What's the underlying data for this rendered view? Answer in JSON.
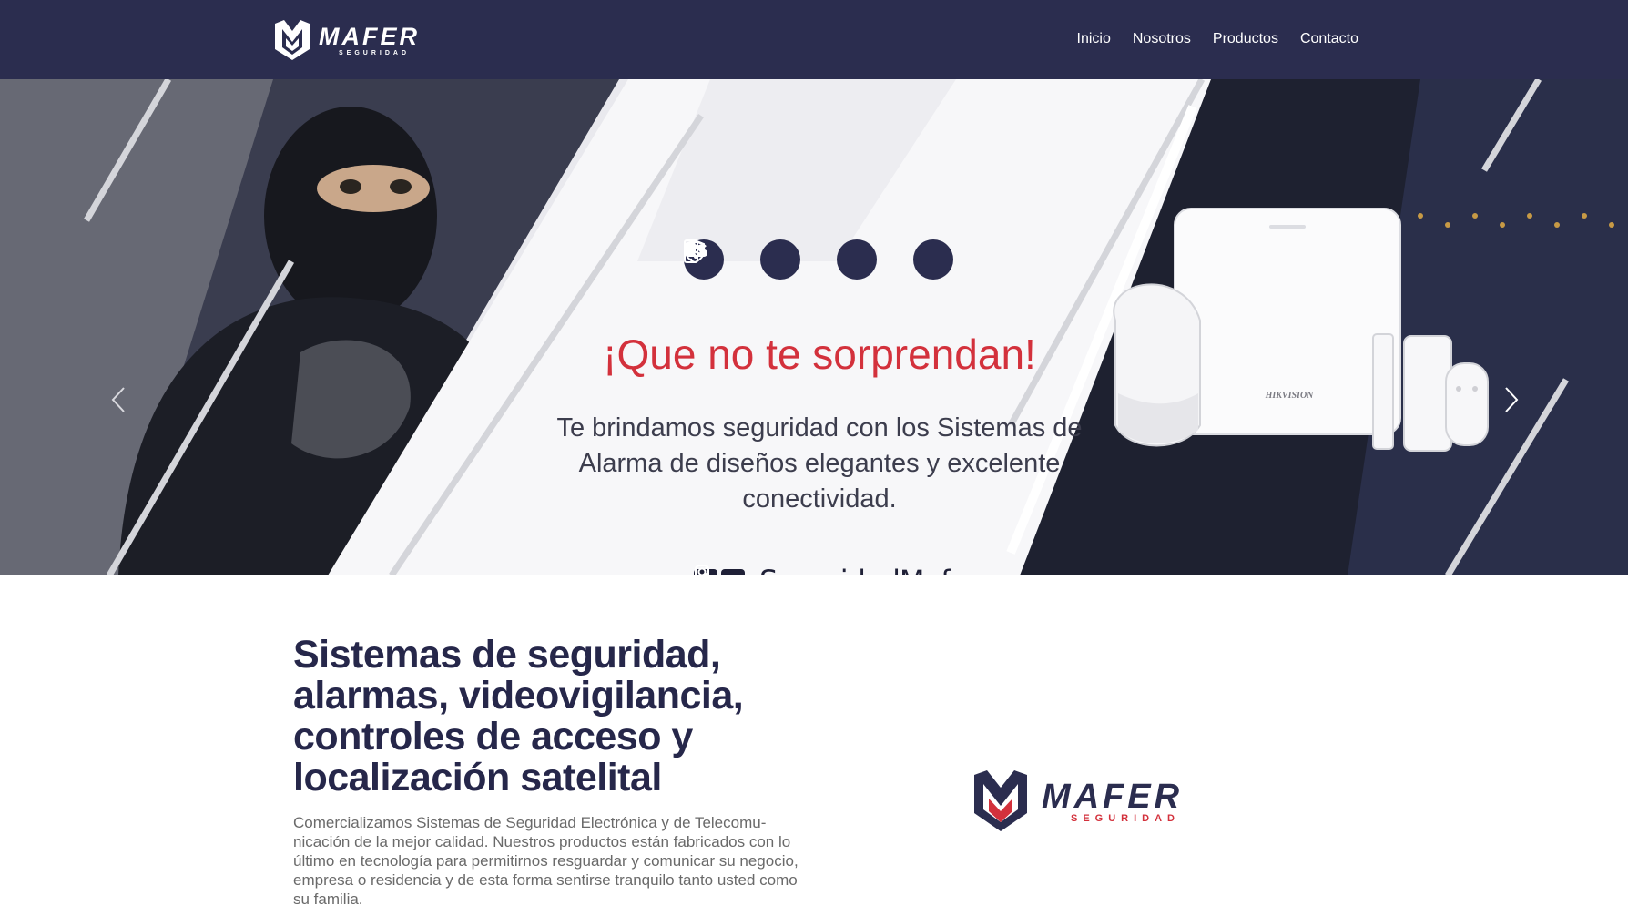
{
  "navbar": {
    "brand": {
      "name": "MAFER",
      "tagline": "SEGURIDAD"
    },
    "links": [
      "Inicio",
      "Nosotros",
      "Productos",
      "Contacto"
    ]
  },
  "hero": {
    "icons": [
      "shield-icon",
      "cloud-download-icon",
      "wifi-icon",
      "smartphone-icon"
    ],
    "headline": "¡Que no te sorprendan!",
    "lead": "Te brindamos seguridad con los Sistemas de Alarma de diseños elegantes y excelente conectividad.",
    "social_handle": "SeguridadMafer",
    "device_brand": "HIKVISION",
    "colors": {
      "navy": "#2b2d4f",
      "red": "#d3313c"
    }
  },
  "content": {
    "title": "Sistemas de seguridad, alarmas, videovigilancia, controles de acceso y localización satelital",
    "description": "Comercializamos Sistemas de Seguridad Electrónica y de Telecomu-nicación de la mejor calidad. Nuestros productos están fabricados con lo último en tecnología para permitirnos resguardar y comunicar su negocio, empresa o residencia y de esta forma sentirse tranquilo tanto usted como su familia."
  },
  "logo": {
    "name": "MAFER",
    "tagline": "SEGURIDAD"
  }
}
